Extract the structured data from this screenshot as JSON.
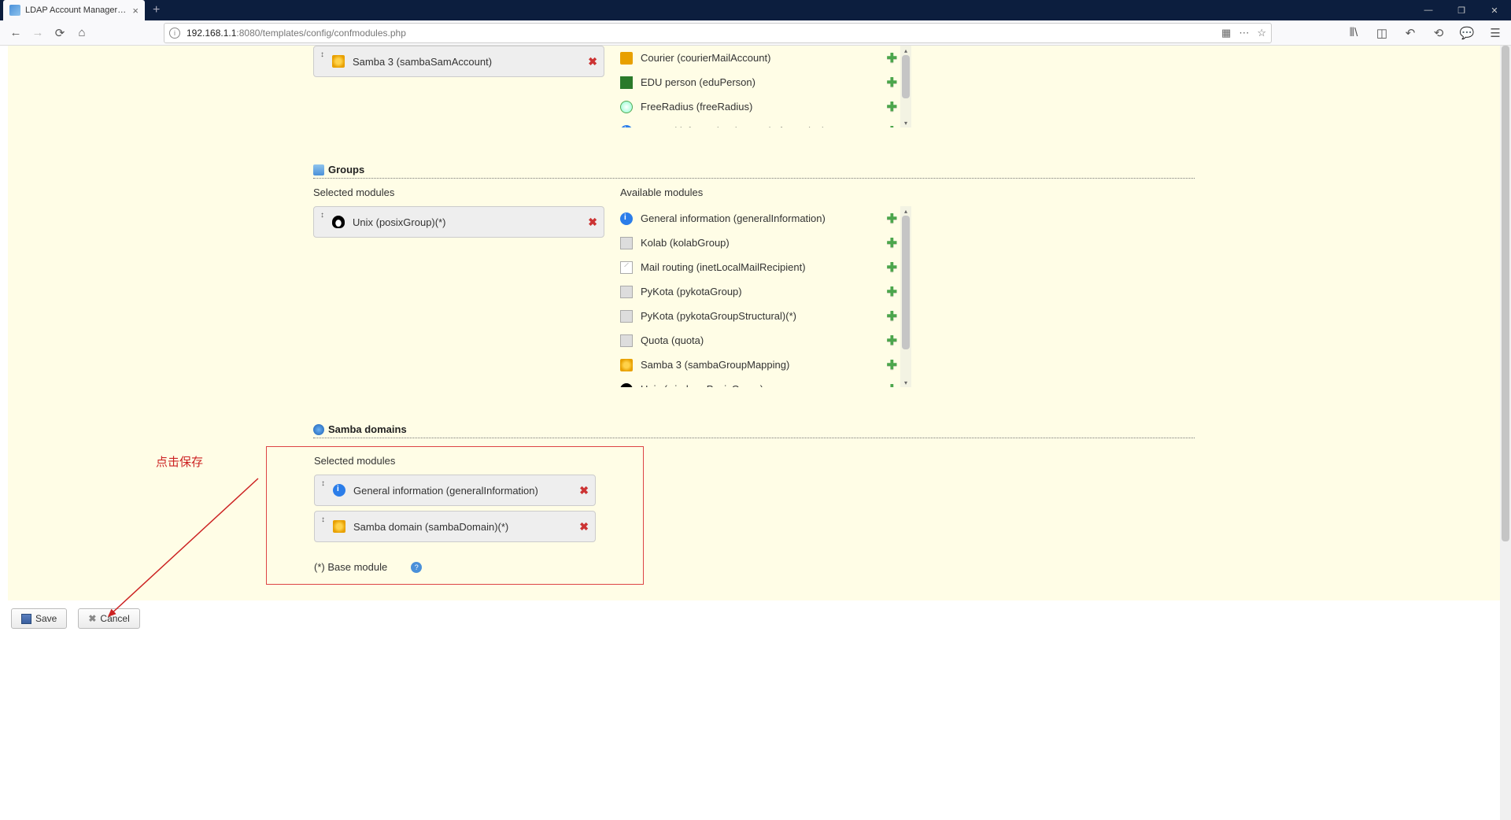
{
  "browser": {
    "tab_title": "LDAP Account Manager Con",
    "url_prefix": "192.168.1.1",
    "url_suffix": ":8080/templates/config/confmodules.php"
  },
  "users_section": {
    "selected": [
      {
        "name": "Samba 3 (sambaSamAccount)",
        "icon": "i-samba"
      }
    ],
    "available": [
      {
        "name": "Courier (courierMailAccount)",
        "icon": "i-courier"
      },
      {
        "name": "EDU person (eduPerson)",
        "icon": "i-edu"
      },
      {
        "name": "FreeRadius (freeRadius)",
        "icon": "i-radius"
      },
      {
        "name": "General information (generalInformation)",
        "icon": "i-info"
      }
    ]
  },
  "groups_section": {
    "title": "Groups",
    "selected_label": "Selected modules",
    "available_label": "Available modules",
    "selected": [
      {
        "name": "Unix (posixGroup)(*)",
        "icon": "i-penguin"
      }
    ],
    "available": [
      {
        "name": "General information (generalInformation)",
        "icon": "i-info"
      },
      {
        "name": "Kolab (kolabGroup)",
        "icon": "i-generic"
      },
      {
        "name": "Mail routing (inetLocalMailRecipient)",
        "icon": "i-mail"
      },
      {
        "name": "PyKota (pykotaGroup)",
        "icon": "i-generic"
      },
      {
        "name": "PyKota (pykotaGroupStructural)(*)",
        "icon": "i-generic"
      },
      {
        "name": "Quota (quota)",
        "icon": "i-generic"
      },
      {
        "name": "Samba 3 (sambaGroupMapping)",
        "icon": "i-samba"
      },
      {
        "name": "Unix (windowsPosixGroup)",
        "icon": "i-penguin"
      }
    ]
  },
  "samba_section": {
    "title": "Samba domains",
    "selected_label": "Selected modules",
    "selected": [
      {
        "name": "General information (generalInformation)",
        "icon": "i-info"
      },
      {
        "name": "Samba domain (sambaDomain)(*)",
        "icon": "i-samba"
      }
    ],
    "base_note": "(*) Base module"
  },
  "annotation": "点击保存",
  "buttons": {
    "save": "Save",
    "cancel": "Cancel"
  }
}
